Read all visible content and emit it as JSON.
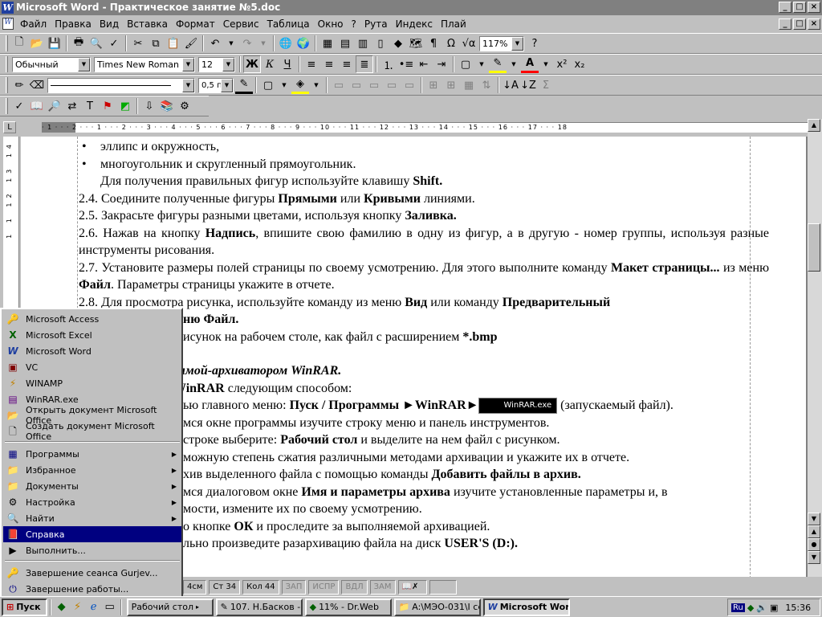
{
  "window": {
    "title": "Microsoft Word - Практическое занятие №5.doc",
    "controls": [
      "_",
      "□",
      "×"
    ]
  },
  "menubar": {
    "items": [
      "Файл",
      "Правка",
      "Вид",
      "Вставка",
      "Формат",
      "Сервис",
      "Таблица",
      "Окно",
      "?",
      "Рута",
      "Индекс",
      "Плай"
    ]
  },
  "formatting": {
    "style": "Обычный",
    "font": "Times New Roman",
    "size": "12",
    "zoom": "117%",
    "line_weight": "0,5 пт"
  },
  "document": {
    "lines": [
      "эллипс и окружность,",
      "многоугольник и скругленный прямоугольник.",
      "Для получения правильных фигур используйте клавишу",
      "Shift.",
      "2.4. Соедините полученные фигуры",
      "Прямыми",
      "или",
      "Кривыми",
      "линиями.",
      "2.5. Закрасьте фигуры разными цветами, используя кнопку",
      "Заливка.",
      "2.6. Нажав на кнопку",
      "Надпись",
      ", впишите свою фамилию в одну из фигур, а в другую - номер группы, используя разные инструменты рисования.",
      "2.7. Установите размеры полей страницы по своему усмотрению. Для этого выполните команду",
      "Макет страницы...",
      "из меню",
      "Файл",
      ". Параметры страницы укажите в отчете.",
      "2.8. Для просмотра рисунка, используйте команду из меню",
      "Вид",
      "или команду",
      "Предварительный",
      "ню Файл.",
      "исунок на рабочем столе, как файл с расширением",
      "*.bmp",
      "граммой-архиватором WinRAR.",
      "WinRAR",
      "следующим способом:",
      "ью главного меню:",
      "Пуск / Программы ►WinRAR►",
      "WinRAR.exe",
      "(запускаемый файл).",
      "мся окне программы изучите строку меню и панель инструментов.",
      "строке выберите:",
      "Рабочий стол",
      "и выделите на нем файл с рисунком.",
      "можную степень сжатия различными методами архивации и укажите их в отчете.",
      "хив выделенного файла с помощью команды",
      "Добавить файлы в архив.",
      "мся диалоговом окне",
      "Имя и параметры архива",
      "изучите установленные параметры и, в",
      "мости, измените их по своему усмотрению.",
      "о кнопке",
      "ОК",
      "и проследите за выполняемой архивацией.",
      "льно произведите разархивацию файла на диск",
      "USER'S (D:)."
    ]
  },
  "status": {
    "pos": "4см",
    "line": "Ст 34",
    "col": "Кол 44",
    "modes": [
      "ЗАП",
      "ИСПР",
      "ВДЛ",
      "ЗАМ"
    ]
  },
  "startmenu": {
    "top_items": [
      "Microsoft Access",
      "Microsoft Excel",
      "Microsoft Word",
      "VC",
      "WINAMP",
      "WinRAR.exe",
      "Открыть документ Microsoft Office",
      "Создать документ Microsoft Office"
    ],
    "main_items": [
      "Программы",
      "Избранное",
      "Документы",
      "Настройка",
      "Найти",
      "Справка",
      "Выполнить..."
    ],
    "bottom_items": [
      "Завершение сеанса Gurjev...",
      "Завершение работы..."
    ],
    "selected": "Справка"
  },
  "taskbar": {
    "start_label": "Пуск",
    "tasks": [
      "Рабочий стол",
      "107. Н.Басков - Т...",
      "11% - Dr.Web",
      "A:\\МЭО-031\\I се...",
      "Microsoft Word - П..."
    ],
    "lang": "Ru",
    "clock": "15:36"
  },
  "ruler_numbers": "· 1 · · · 2 · · · 1 · · · 2 · · · 3 · · · 4 · · · 5 · · · 6 · · · 7 · · · 8 · · · 9 · · · 10 · · · 11 · · · 12 · · · 13 · · · 14 · · · 15 · · · 16 · · · 17 · · · 18",
  "vruler_numbers": "1 1 12 13 14"
}
